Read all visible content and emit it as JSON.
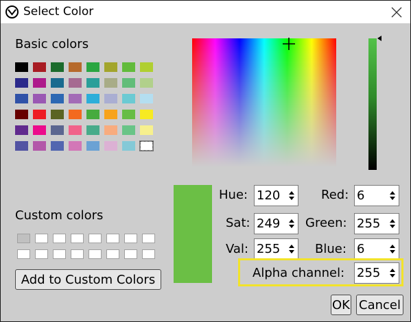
{
  "window": {
    "title": "Select Color"
  },
  "icons": {
    "app": "app-icon",
    "close": "close-icon",
    "crosshair": "crosshair-icon"
  },
  "labels": {
    "basic_colors": "Basic colors",
    "custom_colors": "Custom colors"
  },
  "basic_colors": [
    [
      "#000000",
      "#a81c23",
      "#1b6b2c",
      "#b66a2c",
      "#2aa641",
      "#a3a52c",
      "#62bb3b",
      "#b0cf31"
    ],
    [
      "#2b2a8b",
      "#ae1a8b",
      "#196b8f",
      "#a66a91",
      "#2a9f99",
      "#a8ac87",
      "#62bd79",
      "#b1d08b"
    ],
    [
      "#3052a8",
      "#9a58b3",
      "#2c68b3",
      "#a36bb6",
      "#2caed9",
      "#aaaed2",
      "#6ccad3",
      "#b4def0"
    ],
    [
      "#670000",
      "#ee1c24",
      "#5b6423",
      "#f36a20",
      "#47ab3e",
      "#f7a31c",
      "#67bd45",
      "#f7ea22"
    ],
    [
      "#612a8e",
      "#ec0c8c",
      "#5b6690",
      "#f1628a",
      "#48ab8a",
      "#f8ac7f",
      "#69c487",
      "#f7f08e"
    ],
    [
      "#5253a3",
      "#b358a9",
      "#5266b0",
      "#d377b7",
      "#6ba2d4",
      "#dcb1d4",
      "#84c9d7",
      "#ffffff"
    ]
  ],
  "custom_colors_count": 16,
  "current_color": {
    "hex": "#6bbf45"
  },
  "fields": {
    "hue": {
      "label": "Hue:",
      "value": "120"
    },
    "sat": {
      "label": "Sat:",
      "value": "249"
    },
    "val": {
      "label": "Val:",
      "value": "255"
    },
    "red": {
      "label": "Red:",
      "value": "6"
    },
    "green": {
      "label": "Green:",
      "value": "255"
    },
    "blue": {
      "label": "Blue:",
      "value": "6"
    },
    "alpha": {
      "label": "Alpha channel:",
      "value": "255"
    }
  },
  "buttons": {
    "add_custom": "Add to Custom Colors",
    "ok": "OK",
    "cancel": "Cancel"
  },
  "colors": {
    "highlight": "#f2e32a",
    "client_bg": "#cdcdcd"
  }
}
